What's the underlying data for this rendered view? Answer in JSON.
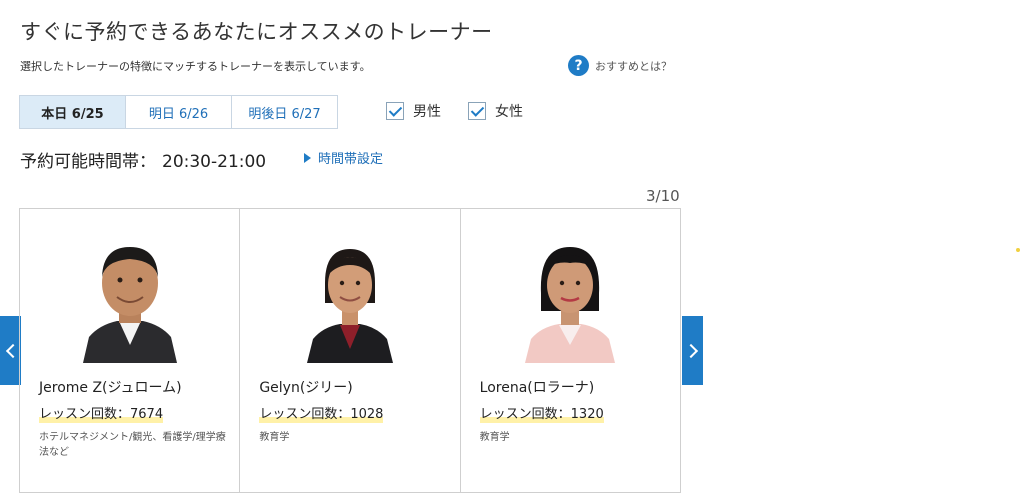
{
  "header": {
    "title": "すぐに予約できるあなたにオススメのトレーナー",
    "subtitle": "選択したトレーナーの特徴にマッチするトレーナーを表示しています。",
    "help_label": "おすすめとは？",
    "help_icon_glyph": "?"
  },
  "date_tabs": [
    {
      "label": "本日 6/25",
      "active": true
    },
    {
      "label": "明日 6/26",
      "active": false
    },
    {
      "label": "明後日 6/27",
      "active": false
    }
  ],
  "filters": {
    "male": {
      "label": "男性",
      "checked": true
    },
    "female": {
      "label": "女性",
      "checked": true
    }
  },
  "timeslot": {
    "label": "予約可能時間帯：",
    "value": "20:30-21:00",
    "setting_link": "時間帯設定"
  },
  "pager": {
    "text": "3/10"
  },
  "trainers": [
    {
      "name": "Jerome Z(ジュローム)",
      "lessons": "レッスン回数：7674",
      "specialty": "ホテルマネジメント/観光、看護学/理学療法など"
    },
    {
      "name": "Gelyn(ジリー)",
      "lessons": "レッスン回数：1028",
      "specialty": "教育学"
    },
    {
      "name": "Lorena(ロラーナ)",
      "lessons": "レッスン回数：1320",
      "specialty": "教育学"
    }
  ],
  "colors": {
    "accent": "#1f7cc6",
    "tab_active_bg": "#dcebf7",
    "highlight": "#fff1a8"
  }
}
